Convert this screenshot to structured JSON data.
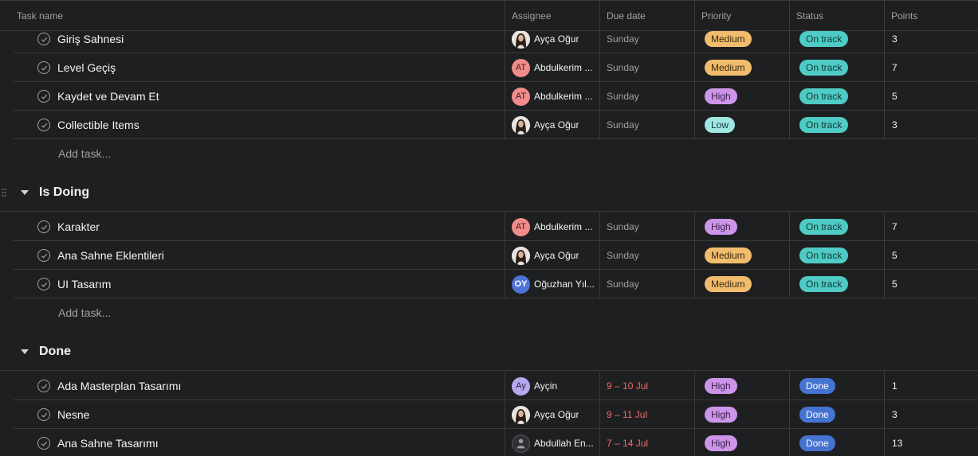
{
  "header": {
    "task_name": "Task name",
    "assignee": "Assignee",
    "due_date": "Due date",
    "priority": "Priority",
    "status": "Status",
    "points": "Points"
  },
  "section_top": {
    "tasks": [
      {
        "name": "Giriş Sahnesi",
        "assignee": "Ayça Oğur",
        "avatar": "photo",
        "due": "Sunday",
        "priority": "Medium",
        "status": "On track",
        "points": "3"
      },
      {
        "name": "Level Geçiş",
        "assignee": "Abdulkerim ...",
        "avatar": "AT",
        "due": "Sunday",
        "priority": "Medium",
        "status": "On track",
        "points": "7"
      },
      {
        "name": "Kaydet ve Devam Et",
        "assignee": "Abdulkerim ...",
        "avatar": "AT",
        "due": "Sunday",
        "priority": "High",
        "status": "On track",
        "points": "5"
      },
      {
        "name": "Collectible Items",
        "assignee": "Ayça Oğur",
        "avatar": "photo",
        "due": "Sunday",
        "priority": "Low",
        "status": "On track",
        "points": "3"
      }
    ],
    "add_task": "Add task..."
  },
  "section_doing": {
    "title": "Is Doing",
    "tasks": [
      {
        "name": "Karakter",
        "assignee": "Abdulkerim ...",
        "avatar": "AT",
        "due": "Sunday",
        "priority": "High",
        "status": "On track",
        "points": "7"
      },
      {
        "name": "Ana Sahne Eklentileri",
        "assignee": "Ayça Oğur",
        "avatar": "photo",
        "due": "Sunday",
        "priority": "Medium",
        "status": "On track",
        "points": "5"
      },
      {
        "name": "UI Tasarım",
        "assignee": "Oğuzhan Yıl...",
        "avatar": "OY",
        "due": "Sunday",
        "priority": "Medium",
        "status": "On track",
        "points": "5"
      }
    ],
    "add_task": "Add task..."
  },
  "section_done": {
    "title": "Done",
    "tasks": [
      {
        "name": "Ada Masterplan Tasarımı",
        "assignee": "Ayçin",
        "avatar": "Ay",
        "due": "9 – 10 Jul",
        "priority": "High",
        "status": "Done",
        "points": "1"
      },
      {
        "name": "Nesne",
        "assignee": "Ayça Oğur",
        "avatar": "photo",
        "due": "9 – 11 Jul",
        "priority": "High",
        "status": "Done",
        "points": "3"
      },
      {
        "name": "Ana Sahne Tasarımı",
        "assignee": "Abdullah En...",
        "avatar": "dark",
        "due": "7 – 14 Jul",
        "priority": "High",
        "status": "Done",
        "points": "13"
      }
    ]
  },
  "avatar_initials": {
    "AT": "AT",
    "OY": "OY",
    "Ay": "Ay"
  },
  "colors": {
    "background": "#1e1f21",
    "medium": "#f1bd6c",
    "high": "#cd95ea",
    "low": "#9ee7e3",
    "on_track": "#4ecbc4",
    "done": "#4573d2",
    "overdue": "#f06a6a"
  }
}
